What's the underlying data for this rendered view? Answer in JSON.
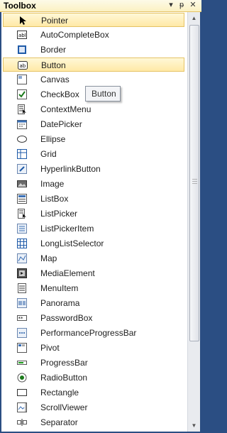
{
  "window": {
    "title": "Toolbox",
    "dropdown_glyph": "▾",
    "pin_glyph": "ᵽ",
    "close_glyph": "✕"
  },
  "tooltip": "Button",
  "items": [
    {
      "label": "Pointer",
      "icon": "pointer-icon",
      "selected": true
    },
    {
      "label": "AutoCompleteBox",
      "icon": "autocompletebox-icon",
      "selected": false
    },
    {
      "label": "Border",
      "icon": "border-icon",
      "selected": false
    },
    {
      "label": "Button",
      "icon": "button-icon",
      "selected": true
    },
    {
      "label": "Canvas",
      "icon": "canvas-icon",
      "selected": false
    },
    {
      "label": "CheckBox",
      "icon": "checkbox-icon",
      "selected": false
    },
    {
      "label": "ContextMenu",
      "icon": "contextmenu-icon",
      "selected": false
    },
    {
      "label": "DatePicker",
      "icon": "datepicker-icon",
      "selected": false
    },
    {
      "label": "Ellipse",
      "icon": "ellipse-icon",
      "selected": false
    },
    {
      "label": "Grid",
      "icon": "grid-icon",
      "selected": false
    },
    {
      "label": "HyperlinkButton",
      "icon": "hyperlinkbutton-icon",
      "selected": false
    },
    {
      "label": "Image",
      "icon": "image-icon",
      "selected": false
    },
    {
      "label": "ListBox",
      "icon": "listbox-icon",
      "selected": false
    },
    {
      "label": "ListPicker",
      "icon": "listpicker-icon",
      "selected": false
    },
    {
      "label": "ListPickerItem",
      "icon": "listpickeritem-icon",
      "selected": false
    },
    {
      "label": "LongListSelector",
      "icon": "longlistselector-icon",
      "selected": false
    },
    {
      "label": "Map",
      "icon": "map-icon",
      "selected": false
    },
    {
      "label": "MediaElement",
      "icon": "mediaelement-icon",
      "selected": false
    },
    {
      "label": "MenuItem",
      "icon": "menuitem-icon",
      "selected": false
    },
    {
      "label": "Panorama",
      "icon": "panorama-icon",
      "selected": false
    },
    {
      "label": "PasswordBox",
      "icon": "passwordbox-icon",
      "selected": false
    },
    {
      "label": "PerformanceProgressBar",
      "icon": "performanceprogressbar-icon",
      "selected": false
    },
    {
      "label": "Pivot",
      "icon": "pivot-icon",
      "selected": false
    },
    {
      "label": "ProgressBar",
      "icon": "progressbar-icon",
      "selected": false
    },
    {
      "label": "RadioButton",
      "icon": "radiobutton-icon",
      "selected": false
    },
    {
      "label": "Rectangle",
      "icon": "rectangle-icon",
      "selected": false
    },
    {
      "label": "ScrollViewer",
      "icon": "scrollviewer-icon",
      "selected": false
    },
    {
      "label": "Separator",
      "icon": "separator-icon",
      "selected": false
    }
  ],
  "colors": {
    "frame": "#2b4e83",
    "titlebar": "#fbf1c2",
    "selection": "#ffe9a7",
    "selection_border": "#e5c365"
  }
}
